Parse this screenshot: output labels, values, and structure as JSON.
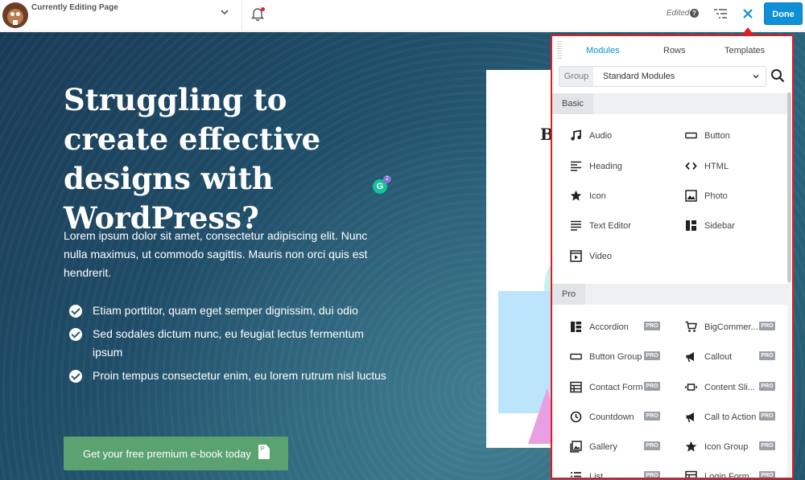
{
  "topbar": {
    "page_label": "Currently Editing Page",
    "edited": "Edited",
    "help": "?",
    "done": "Done"
  },
  "hero": {
    "headline": "Struggling to create effective designs with WordPress?",
    "intro": "Lorem ipsum dolor sit amet, consectetur adipiscing elit. Nunc nulla maximus, ut commodo sagittis. Mauris non orci quis est hendrerit.",
    "bullets": [
      "Etiam porttitor, quam eget semper dignissim, dui odio",
      "Sed sodales dictum nunc, eu feugiat lectus fermentum ipsum",
      "Proin tempus consectetur enim, eu lorem  rutrum nisl luctus"
    ],
    "cta": "Get your free premium e-book today",
    "grammarly_letter": "G",
    "grammarly_count": "2",
    "card_letter": "B"
  },
  "panel": {
    "tabs": [
      "Modules",
      "Rows",
      "Templates"
    ],
    "group_label": "Group",
    "group_value": "Standard Modules",
    "sections": [
      {
        "title": "Basic",
        "modules": [
          "Audio",
          "Button",
          "Heading",
          "HTML",
          "Icon",
          "Photo",
          "Text Editor",
          "Sidebar",
          "Video"
        ]
      },
      {
        "title": "Pro",
        "badge": "PRO",
        "modules": [
          "Accordion",
          "BigCommer...",
          "Button Group",
          "Callout",
          "Contact Form",
          "Content Sli...",
          "Countdown",
          "Call to Action",
          "Gallery",
          "Icon Group",
          "List",
          "Login Form"
        ]
      }
    ]
  },
  "colors": {
    "accent": "#0e8fd6",
    "highlight_border": "#e21b23",
    "cta": "#5aa26f",
    "pro_badge": "#9aa0a6"
  }
}
